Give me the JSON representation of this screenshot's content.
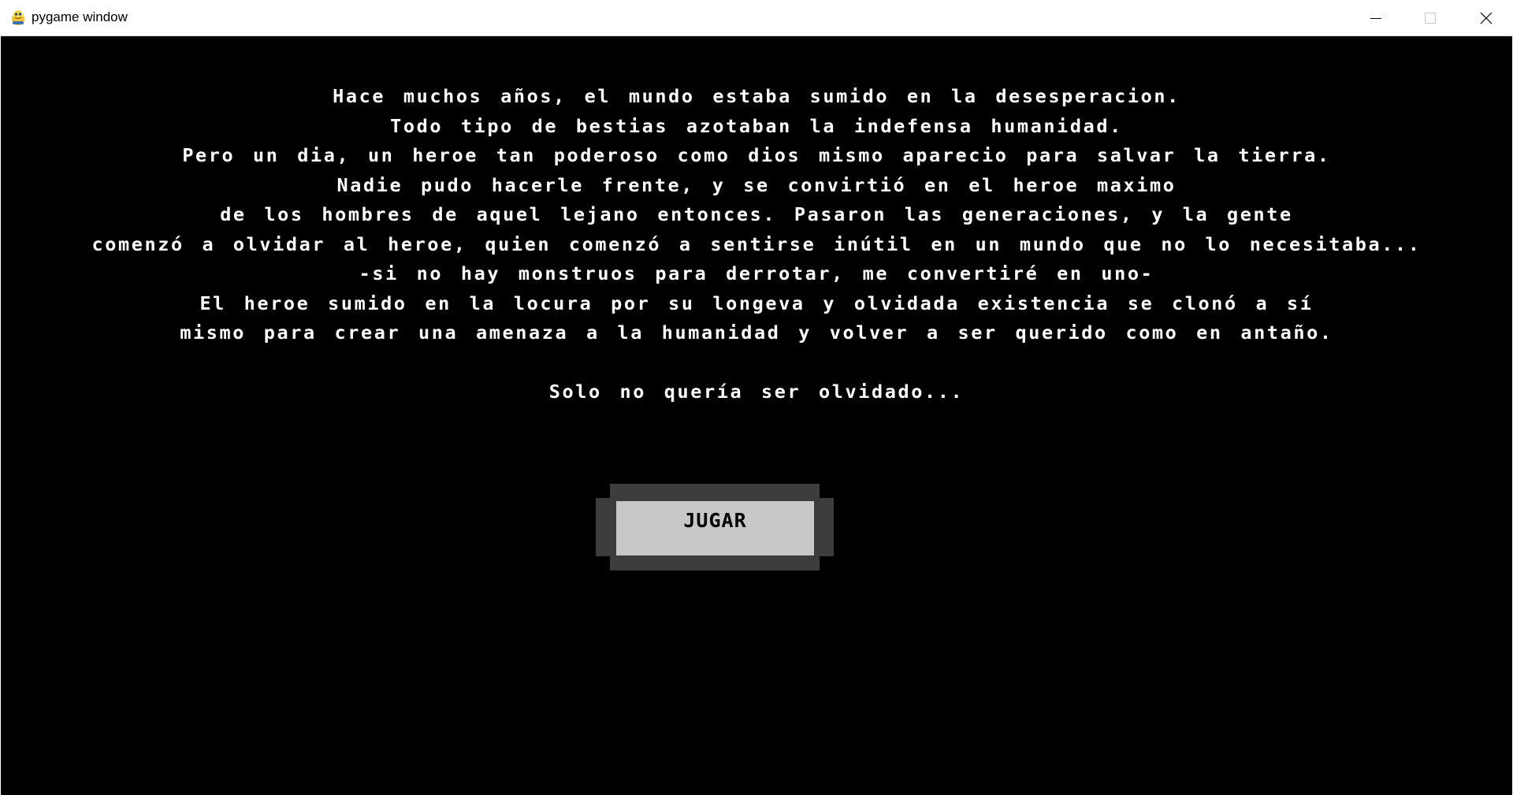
{
  "window": {
    "title": "pygame window",
    "controls": {
      "minimize_icon": "minimize-icon",
      "maximize_icon": "maximize-icon",
      "close_icon": "close-icon"
    }
  },
  "game": {
    "background_color": "#000000",
    "text_color": "#ffffff",
    "story_lines": [
      "Hace muchos años, el mundo estaba sumido en la desesperacion.",
      "Todo tipo de bestias azotaban la indefensa humanidad.",
      "Pero un dia, un heroe tan poderoso como dios mismo aparecio para salvar la tierra.",
      "Nadie pudo hacerle frente, y se convirtió en el heroe maximo",
      "de los hombres de aquel lejano entonces. Pasaron las generaciones, y la gente",
      "comenzó a olvidar al heroe, quien comenzó a sentirse inútil en un mundo que no lo necesitaba...",
      "-si no hay monstruos para derrotar, me convertiré en uno-",
      "El heroe sumido en la locura por su longeva y olvidada existencia se clonó a sí",
      "mismo para crear una amenaza a la humanidad y volver a ser querido como en antaño.",
      "",
      "Solo no quería ser olvidado..."
    ],
    "play_button": {
      "label": "JUGAR",
      "fill_color": "#c8c8c8",
      "frame_color": "#3c3c3c"
    }
  }
}
